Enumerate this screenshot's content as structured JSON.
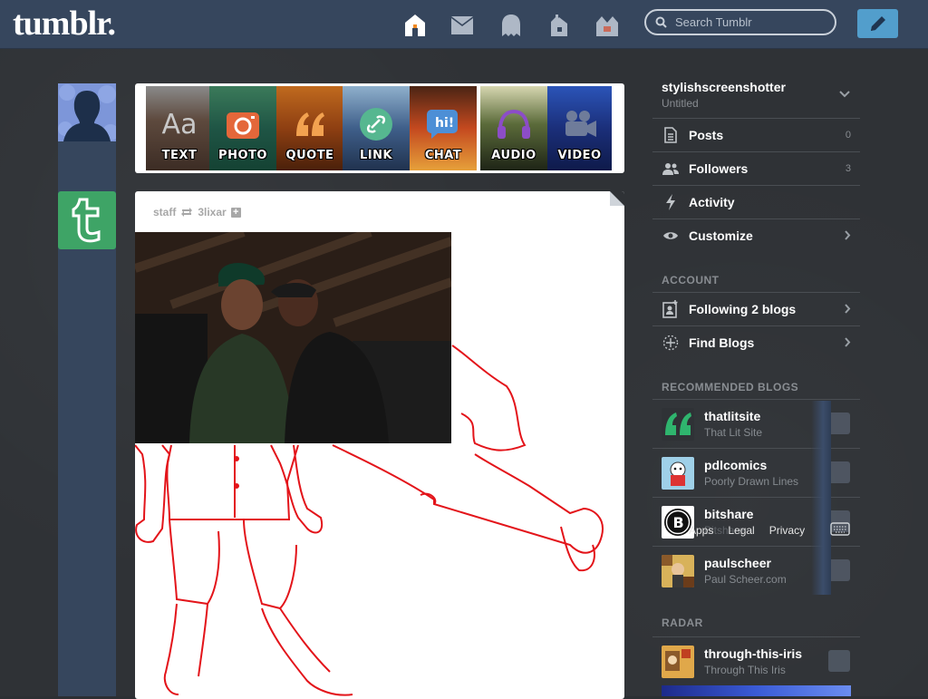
{
  "header": {
    "logo": "tumblr.",
    "nav": [
      "home-icon",
      "inbox-icon",
      "ghost-icon",
      "house-icon",
      "store-icon"
    ],
    "search_placeholder": "Search Tumblr",
    "compose": "pencil-icon"
  },
  "post_types": [
    {
      "label": "TEXT",
      "icon": "text-icon",
      "color": "#7a5d4a"
    },
    {
      "label": "PHOTO",
      "icon": "camera-icon",
      "color": "#2d6b56"
    },
    {
      "label": "QUOTE",
      "icon": "quote-icon",
      "color": "#b8561c"
    },
    {
      "label": "LINK",
      "icon": "link-icon",
      "color": "#4a7fb0"
    },
    {
      "label": "CHAT",
      "icon": "chat-icon",
      "color": "#c4491f"
    },
    {
      "label": "AUDIO",
      "icon": "headphones-icon",
      "color": "#5b6b3a"
    },
    {
      "label": "VIDEO",
      "icon": "video-camera-icon",
      "color": "#1f3e8c"
    }
  ],
  "post": {
    "author": "staff",
    "reblogged_from": "3lixar",
    "follow_symbol": "+"
  },
  "sidebar": {
    "blog_name": "stylishscreenshotter",
    "blog_subtitle": "Untitled",
    "rows": [
      {
        "label": "Posts",
        "count": "0",
        "icon": "document-icon"
      },
      {
        "label": "Followers",
        "count": "3",
        "icon": "users-icon"
      },
      {
        "label": "Activity",
        "count": "",
        "icon": "lightning-icon"
      },
      {
        "label": "Customize",
        "count": "",
        "icon": "eye-icon"
      }
    ],
    "account_title": "ACCOUNT",
    "account_rows": [
      {
        "label": "Following 2 blogs",
        "icon": "following-icon"
      },
      {
        "label": "Find Blogs",
        "icon": "compass-icon"
      }
    ],
    "recommended_title": "RECOMMENDED BLOGS",
    "recommended": [
      {
        "name": "thatlitsite",
        "desc": "That Lit Site"
      },
      {
        "name": "pdlcomics",
        "desc": "Poorly Drawn Lines"
      },
      {
        "name": "bitshare",
        "desc": "Bitshare"
      },
      {
        "name": "paulscheer",
        "desc": "Paul Scheer.com"
      }
    ],
    "footer_links": [
      "Apps",
      "Legal",
      "Privacy"
    ],
    "radar_title": "RADAR",
    "radar": {
      "name": "through-this-iris",
      "desc": "Through This Iris"
    }
  },
  "colors": {
    "header_bg": "#36465d",
    "page_bg": "#2f3236",
    "accent": "#529ecc",
    "tumblr_green": "#3ea466"
  }
}
